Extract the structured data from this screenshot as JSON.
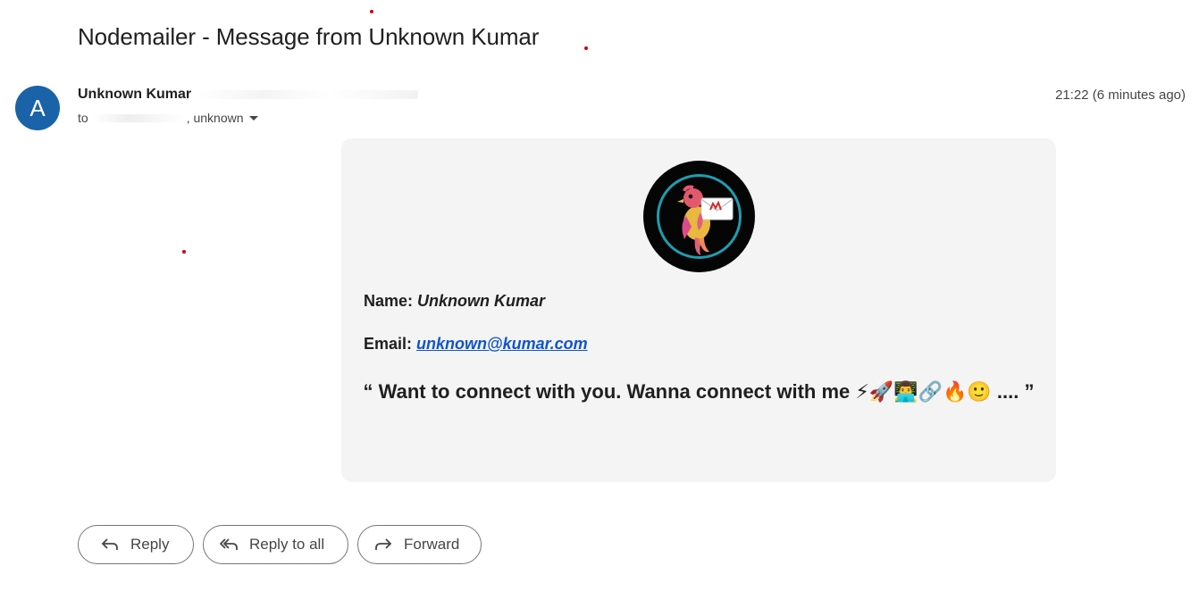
{
  "email": {
    "subject": "Nodemailer - Message from Unknown Kumar",
    "sender": {
      "initial": "A",
      "name": "Unknown Kumar"
    },
    "to_prefix": "to",
    "recipient_visible": ", unknown",
    "timestamp": "21:22 (6 minutes ago)"
  },
  "body": {
    "name_label": "Name:",
    "name_value": "Unknown Kumar",
    "email_label": "Email:",
    "email_value": "unknown@kumar.com",
    "message_open_quote": "“",
    "message_text": "Want to connect with you. Wanna connect with me ⚡🚀👨‍💻🔗🔥🙂 ....",
    "message_close_quote": "”"
  },
  "actions": {
    "reply": "Reply",
    "reply_all": "Reply to all",
    "forward": "Forward"
  },
  "colors": {
    "avatar_bg": "#1a63a8",
    "link": "#1155cc",
    "card_bg": "#f4f4f4",
    "logo_ring": "#1e9db0"
  },
  "icons": [
    "reply-icon",
    "reply-all-icon",
    "forward-icon",
    "nodemailer-bird-logo",
    "chevron-down-icon"
  ]
}
